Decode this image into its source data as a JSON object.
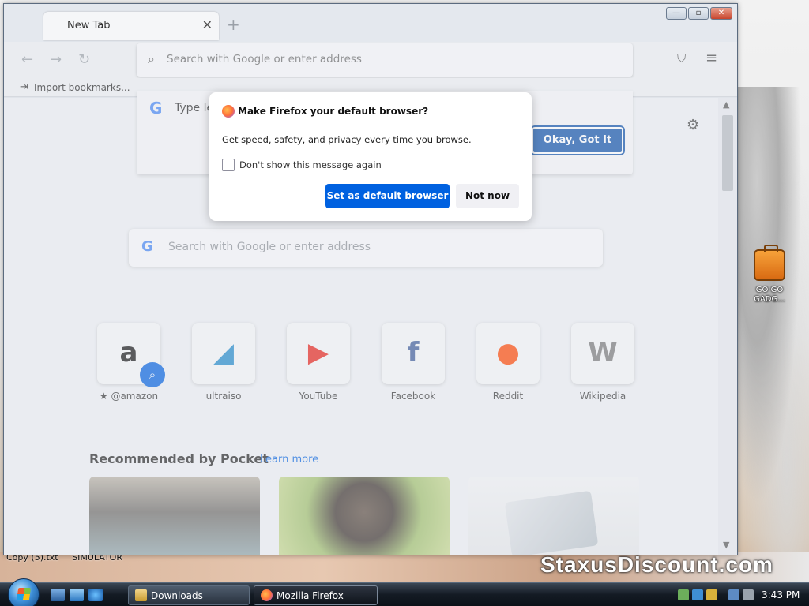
{
  "browser": {
    "tab_title": "New Tab",
    "urlbar_placeholder": "Search with Google or enter address",
    "bookmarks": {
      "import_label": "Import bookmarks..."
    },
    "dropdown": {
      "typed_prefix": "Type le",
      "okay_button": "Okay, Got It"
    }
  },
  "modal": {
    "title": "Make Firefox your default browser?",
    "body": "Get speed, safety, and privacy every time you browse.",
    "checkbox_label": "Don't show this message again",
    "primary_button": "Set as default browser",
    "secondary_button": "Not now"
  },
  "newtab": {
    "search_placeholder": "Search with Google or enter address",
    "top_sites": [
      {
        "name": "@amazon",
        "glyph": "a",
        "color": "#111111"
      },
      {
        "name": "ultraiso",
        "glyph": "◢",
        "color": "#1e88c9"
      },
      {
        "name": "YouTube",
        "glyph": "▶",
        "color": "#e62117"
      },
      {
        "name": "Facebook",
        "glyph": "f",
        "color": "#3b5998"
      },
      {
        "name": "Reddit",
        "glyph": "●",
        "color": "#ff4500"
      },
      {
        "name": "Wikipedia",
        "glyph": "W",
        "color": "#777777"
      }
    ],
    "pocket": {
      "title": "Recommended by Pocket",
      "learn_more": "Learn more"
    }
  },
  "desktop": {
    "icon_label": "GO GO GADG...",
    "file_labels": [
      "Copy (5).txt",
      "SIMULATOR"
    ],
    "watermark": "StaxusDiscount.com"
  },
  "taskbar": {
    "buttons": [
      {
        "label": "Downloads"
      },
      {
        "label": "Mozilla Firefox"
      }
    ],
    "clock": "3:43 PM"
  },
  "colors": {
    "accent": "#0061e0",
    "okay_button": "#0b4fa8",
    "taskbar": "#141b24"
  }
}
